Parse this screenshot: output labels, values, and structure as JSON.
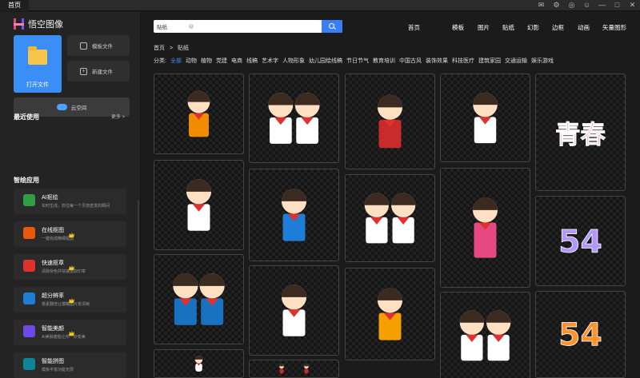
{
  "titlebar": {
    "tab": "首页"
  },
  "brand": {
    "name": "悟空图像"
  },
  "actions": {
    "open_file": "打开文件",
    "template_file": "模板文件",
    "new_file": "新建文件",
    "cloud": "云空间"
  },
  "recent": {
    "title": "最近使用",
    "more": "更多 >"
  },
  "smart_apps": {
    "title": "智绘应用",
    "items": [
      {
        "name": "AI抠绘",
        "desc": "实时生成，抓住每一个灵感迸发的瞬间",
        "color": "#2f9e44",
        "vip": false
      },
      {
        "name": "在线抠图",
        "desc": "一键完成精细抠图",
        "color": "#e8590c",
        "vip": true
      },
      {
        "name": "快速抠章",
        "desc": "清除杂色并快速抠取印章",
        "color": "#e03131",
        "vip": true
      },
      {
        "name": "超分辨率",
        "desc": "像素翻倍让模糊图片变清晰",
        "color": "#1c7ed6",
        "vip": true
      },
      {
        "name": "智能美颜",
        "desc": "AI美肤瘦脸让你一秒变美",
        "color": "#7048e8",
        "vip": true
      },
      {
        "name": "智能拼图",
        "desc": "模板丰富功能无限",
        "color": "#0c8599",
        "vip": false
      }
    ]
  },
  "search": {
    "value": "贴纸",
    "clear": "×"
  },
  "topnav": [
    "首页",
    "模板",
    "图片",
    "贴纸",
    "幻影",
    "边框",
    "动画",
    "矢量图形"
  ],
  "breadcrumb": [
    "首页",
    ">",
    "贴纸"
  ],
  "categories": {
    "label": "分类:",
    "items": [
      "全部",
      "动物",
      "植物",
      "党建",
      "电商",
      "线稿",
      "艺术字",
      "人物形象",
      "幼儿园绘线稿",
      "节日节气",
      "教育培训",
      "中国古风",
      "装饰效果",
      "科技医疗",
      "建筑家园",
      "交通运输",
      "娱乐游戏"
    ],
    "active": "全部"
  },
  "grid": [
    {
      "title": "bowl-sticker"
    },
    {
      "title": "two-kids"
    },
    {
      "title": "flag-kids"
    },
    {
      "title": "boy-uniform"
    },
    {
      "title": "youth-text",
      "text": "青春"
    },
    {
      "title": "girl-salute"
    },
    {
      "title": "pigtail-kids"
    },
    {
      "title": "girl-red-skirt"
    },
    {
      "title": "boy-backpack"
    },
    {
      "title": "54-purple",
      "text": "54"
    },
    {
      "title": "boy-scarf"
    },
    {
      "title": "kids-group"
    },
    {
      "title": "two-boys"
    },
    {
      "title": "paint-splash"
    },
    {
      "title": "54-orange",
      "text": "54"
    },
    {
      "title": "girl-bottom"
    },
    {
      "title": "flower-bottom"
    }
  ]
}
